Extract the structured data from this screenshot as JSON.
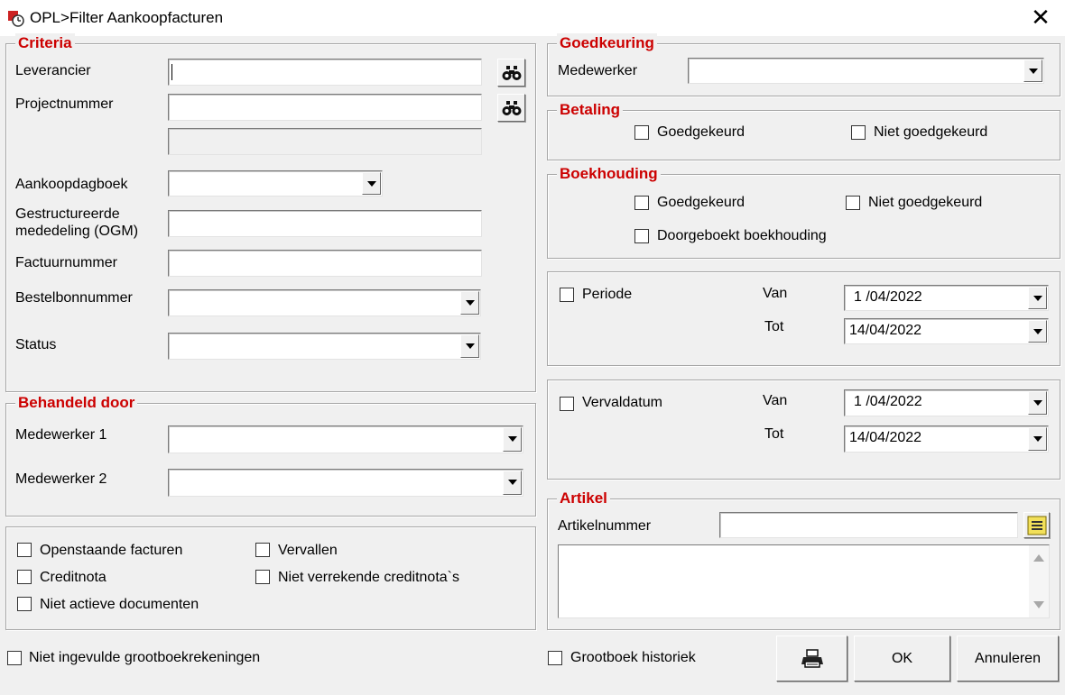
{
  "window": {
    "title": "OPL>Filter Aankoopfacturen",
    "close_glyph": "✕"
  },
  "criteria": {
    "legend": "Criteria",
    "leverancier": {
      "label": "Leverancier",
      "value": ""
    },
    "projectnummer": {
      "label": "Projectnummer",
      "value": "",
      "extra_value": ""
    },
    "aankoopdagboek": {
      "label": "Aankoopdagboek",
      "value": ""
    },
    "ogm": {
      "label_line1": "Gestructureerde",
      "label_line2": "mededeling (OGM)",
      "value": ""
    },
    "factuurnummer": {
      "label": "Factuurnummer",
      "value": ""
    },
    "bestelbonnummer": {
      "label": "Bestelbonnummer",
      "value": ""
    },
    "status": {
      "label": "Status",
      "value": ""
    }
  },
  "behandeld": {
    "legend": "Behandeld door",
    "medewerker1": {
      "label": "Medewerker 1",
      "value": ""
    },
    "medewerker2": {
      "label": "Medewerker 2",
      "value": ""
    }
  },
  "options": {
    "openstaande": "Openstaande facturen",
    "vervallen": "Vervallen",
    "creditnota": "Creditnota",
    "niet_verrekende": "Niet verrekende creditnota`s",
    "niet_actieve": "Niet actieve documenten"
  },
  "goedkeuring": {
    "legend": "Goedkeuring",
    "medewerker_label": "Medewerker",
    "medewerker_value": ""
  },
  "betaling": {
    "legend": "Betaling",
    "goedgekeurd": "Goedgekeurd",
    "niet_goedgekeurd": "Niet goedgekeurd"
  },
  "boekhouding": {
    "legend": "Boekhouding",
    "goedgekeurd": "Goedgekeurd",
    "niet_goedgekeurd": "Niet goedgekeurd",
    "doorgeboekt": "Doorgeboekt boekhouding"
  },
  "periode": {
    "label": "Periode",
    "van_label": "Van",
    "tot_label": "Tot",
    "van_value": "1 /04/2022",
    "tot_value": "14/04/2022"
  },
  "vervaldatum": {
    "label": "Vervaldatum",
    "van_label": "Van",
    "tot_label": "Tot",
    "van_value": "1 /04/2022",
    "tot_value": "14/04/2022"
  },
  "artikel": {
    "legend": "Artikel",
    "nummer_label": "Artikelnummer",
    "nummer_value": ""
  },
  "footer": {
    "niet_ingevulde": "Niet ingevulde grootboekrekeningen",
    "grootboek_historiek": "Grootboek historiek",
    "ok_label": "OK",
    "annuleren_label": "Annuleren"
  }
}
